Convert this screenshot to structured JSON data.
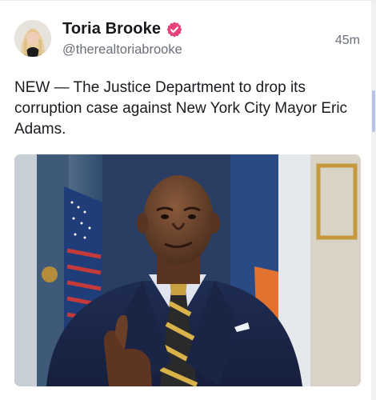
{
  "post": {
    "author": {
      "display_name": "Toria Brooke",
      "handle": "@therealtoriabrooke",
      "verified_icon": "verified-badge-icon",
      "verified_color": "#e7437a"
    },
    "timestamp": "45m",
    "text": "NEW — The Justice Department to drop its corruption case against New York City Mayor Eric Adams.",
    "media": {
      "kind": "photo"
    }
  },
  "colors": {
    "name": "#17181c",
    "secondary_text": "#6b6f7b",
    "scroll_thumb": "#b9c3ea"
  }
}
